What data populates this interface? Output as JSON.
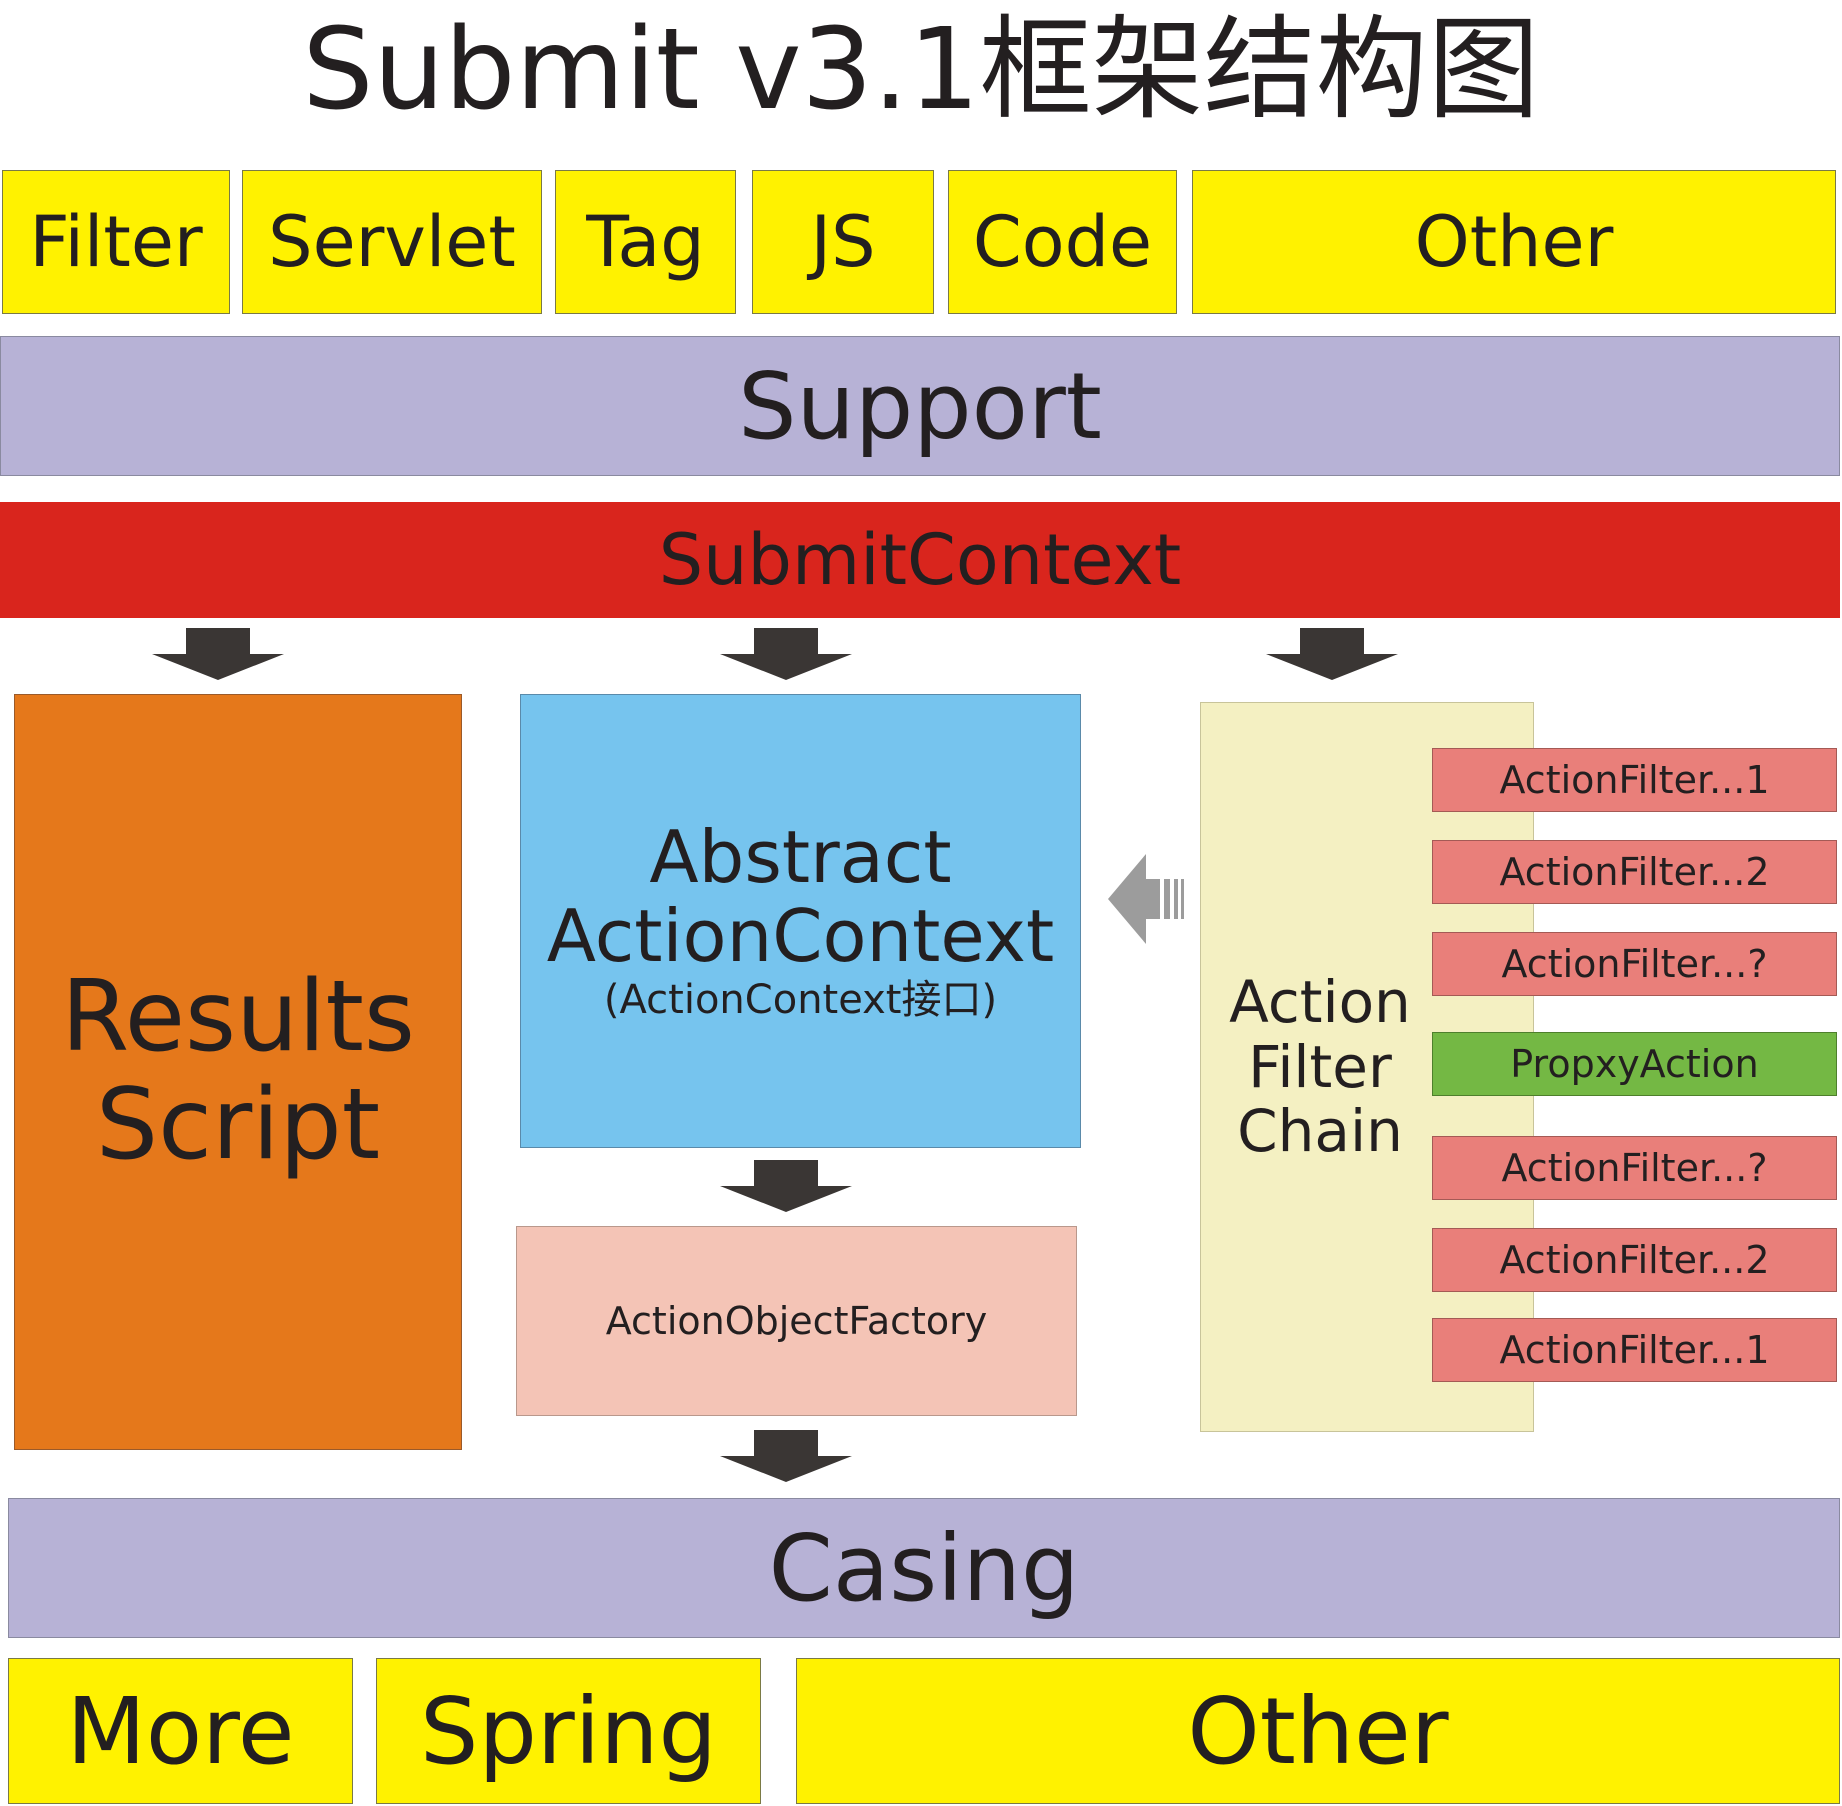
{
  "title": "Submit v3.1框架结构图",
  "top_row": [
    "Filter",
    "Servlet",
    "Tag",
    "JS",
    "Code",
    "Other"
  ],
  "support": "Support",
  "submit_context": "SubmitContext",
  "results_script": {
    "line1": "Results",
    "line2": "Script"
  },
  "abstract_action_context": {
    "line1": "Abstract",
    "line2": "ActionContext",
    "line3": "(ActionContext接口)"
  },
  "action_object_factory": "ActionObjectFactory",
  "action_filter_chain": {
    "line1": "Action",
    "line2": "Filter",
    "line3": "Chain"
  },
  "filters": [
    "ActionFilter...1",
    "ActionFilter...2",
    "ActionFilter...?",
    "PropxyAction",
    "ActionFilter...?",
    "ActionFilter...2",
    "ActionFilter...1"
  ],
  "casing": "Casing",
  "bottom_row": [
    "More",
    "Spring",
    "Other"
  ],
  "colors": {
    "yellow": "#fff200",
    "purple": "#b7b2d6",
    "red": "#d9251d",
    "orange": "#e5781b",
    "blue": "#76c4ee",
    "pink": "#f4c4b6",
    "cream": "#f4f0c2",
    "salmon": "#e97f7a",
    "green": "#74b844",
    "arrow": "#3a3634"
  }
}
